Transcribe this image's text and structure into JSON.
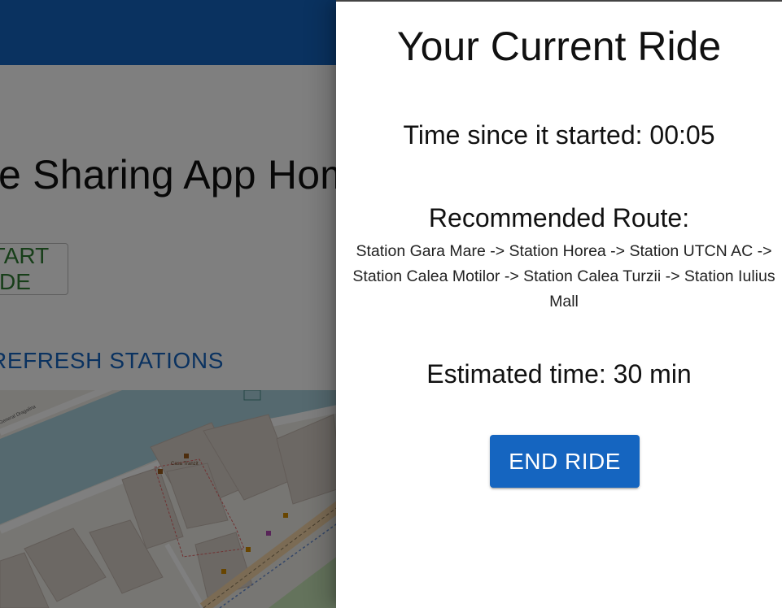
{
  "background_page": {
    "page_title": "Bike Sharing App Home",
    "start_ride_label": "START RIDE",
    "refresh_stations_label": "REFRESH STATIONS",
    "map": {
      "street_label": "General Dragalina",
      "poi_label": "Casa Tranzit"
    }
  },
  "drawer": {
    "title": "Your Current Ride",
    "elapsed_label": "Time since it started:",
    "elapsed_value": "00:05",
    "route_heading": "Recommended Route:",
    "route_text": "Station Gara Mare -> Station Horea -> Station UTCN AC -> Station Calea Motilor -> Station Calea Turzii -> Station Iulius Mall",
    "eta_label": "Estimated time:",
    "eta_value": "30 min",
    "end_ride_label": "END RIDE"
  },
  "colors": {
    "appbar": "#1565c0",
    "primary": "#1565c0",
    "start_ride_text": "#2e7d32"
  }
}
